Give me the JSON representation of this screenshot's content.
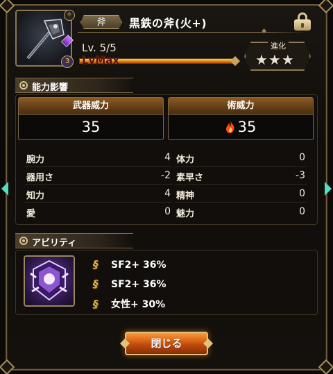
{
  "weapon": {
    "type": "斧",
    "name": "黒鉄の斧(火+)",
    "level_text": "Lv. 5/5",
    "level_bar_label": "LvMax",
    "level_progress": 1.0,
    "rank_badge": "3",
    "evolution_label": "進化",
    "evolution_stars": "★★★"
  },
  "ability_influence": {
    "header": "能力影響",
    "weapon_power_label": "武器威力",
    "weapon_power_value": "35",
    "magic_power_label": "術威力",
    "magic_power_value": "35",
    "magic_power_element": "fire-icon",
    "stats": [
      {
        "label": "腕力",
        "value": "4"
      },
      {
        "label": "体力",
        "value": "0"
      },
      {
        "label": "器用さ",
        "value": "-2"
      },
      {
        "label": "素早さ",
        "value": "-3"
      },
      {
        "label": "知力",
        "value": "4"
      },
      {
        "label": "精神",
        "value": "0"
      },
      {
        "label": "愛",
        "value": "0"
      },
      {
        "label": "魅力",
        "value": "0"
      }
    ]
  },
  "abilities": {
    "header": "アビリティ",
    "items": [
      {
        "icon": "swirl-icon",
        "text": "SF2+ 36%"
      },
      {
        "icon": "swirl-icon",
        "text": "SF2+ 36%"
      },
      {
        "icon": "swirl-icon",
        "text": "女性+ 30%"
      }
    ]
  },
  "close_button": "閉じる",
  "colors": {
    "accent_gold": "#c4ac78",
    "button_orange": "#e0701a",
    "nav_arrow": "#50e0c0"
  }
}
